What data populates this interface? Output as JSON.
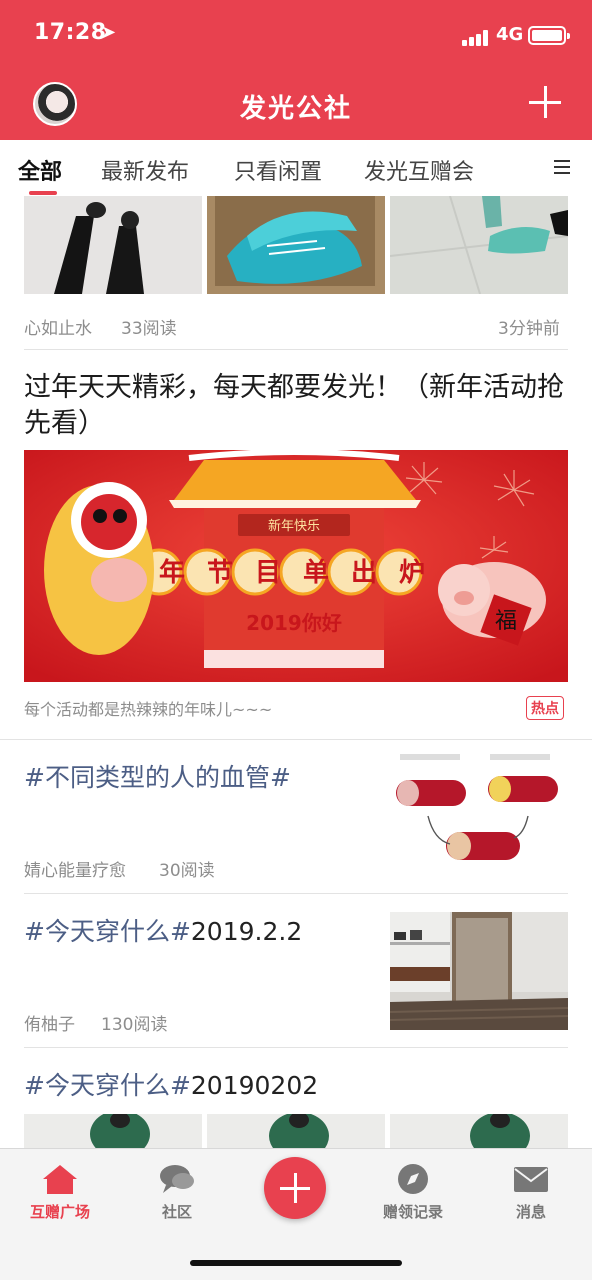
{
  "status_bar": {
    "time": "17:28",
    "network": "4G"
  },
  "header": {
    "title": "发光公社"
  },
  "tabs": [
    {
      "label": "全部"
    },
    {
      "label": "最新发布"
    },
    {
      "label": "只看闲置"
    },
    {
      "label": "发光互赠会"
    }
  ],
  "feed": {
    "post1": {
      "author": "心如止水",
      "reads": "33阅读",
      "time": "3分钟前"
    },
    "post2": {
      "title": "过年天天精彩，每天都要发光！（新年活动抢先看）",
      "banner_text": {
        "top": "新年快乐",
        "main": "过年节目单出炉",
        "year": "2019你好",
        "fu": "福"
      },
      "caption": "每个活动都是热辣辣的年味儿~~~",
      "badge": "热点"
    },
    "post3": {
      "tag": "#不同类型的人的血管#",
      "author": "婧心能量疗愈",
      "reads": "30阅读"
    },
    "post4": {
      "tag": "#今天穿什么#",
      "date": "2019.2.2",
      "author": "侑柚子",
      "reads": "130阅读"
    },
    "post5": {
      "tag": "#今天穿什么#",
      "date": "20190202"
    }
  },
  "tabbar": {
    "items": [
      {
        "label": "互赠广场"
      },
      {
        "label": "社区"
      },
      {
        "label": "赠领记录"
      },
      {
        "label": "消息"
      }
    ]
  },
  "colors": {
    "brand": "#e8414f",
    "topic": "#4c5e85"
  }
}
